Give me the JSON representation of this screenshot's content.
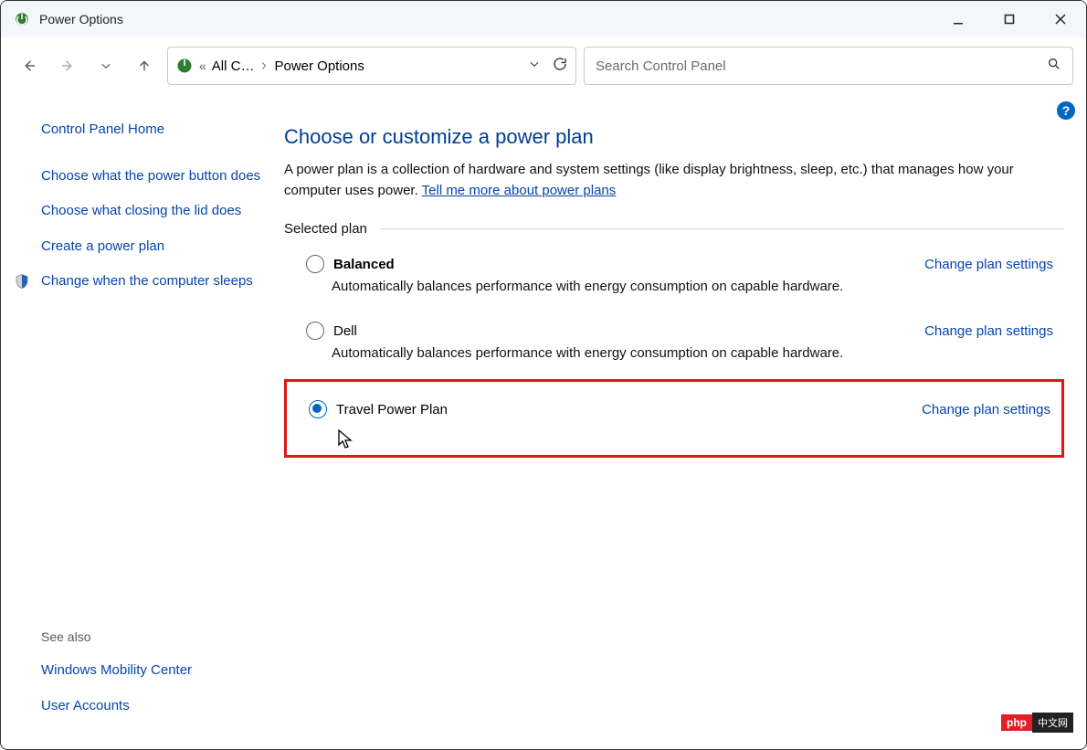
{
  "window": {
    "title": "Power Options"
  },
  "address": {
    "crumb1": "All C…",
    "crumb2": "Power Options"
  },
  "search": {
    "placeholder": "Search Control Panel"
  },
  "sidebar": {
    "home": "Control Panel Home",
    "links": [
      "Choose what the power button does",
      "Choose what closing the lid does",
      "Create a power plan",
      "Change when the computer sleeps"
    ],
    "see_also_label": "See also",
    "see_also": [
      "Windows Mobility Center",
      "User Accounts"
    ]
  },
  "main": {
    "heading": "Choose or customize a power plan",
    "desc_text": "A power plan is a collection of hardware and system settings (like display brightness, sleep, etc.) that manages how your computer uses power. ",
    "desc_link": "Tell me more about power plans",
    "section_label": "Selected plan",
    "change_link": "Change plan settings",
    "plans": [
      {
        "name": "Balanced",
        "bold": true,
        "selected": false,
        "desc": "Automatically balances performance with energy consumption on capable hardware."
      },
      {
        "name": "Dell",
        "bold": false,
        "selected": false,
        "desc": "Automatically balances performance with energy consumption on capable hardware."
      },
      {
        "name": "Travel Power Plan",
        "bold": false,
        "selected": true,
        "desc": ""
      }
    ]
  },
  "watermark": {
    "left": "php",
    "right": "中文网"
  },
  "help_badge": "?"
}
